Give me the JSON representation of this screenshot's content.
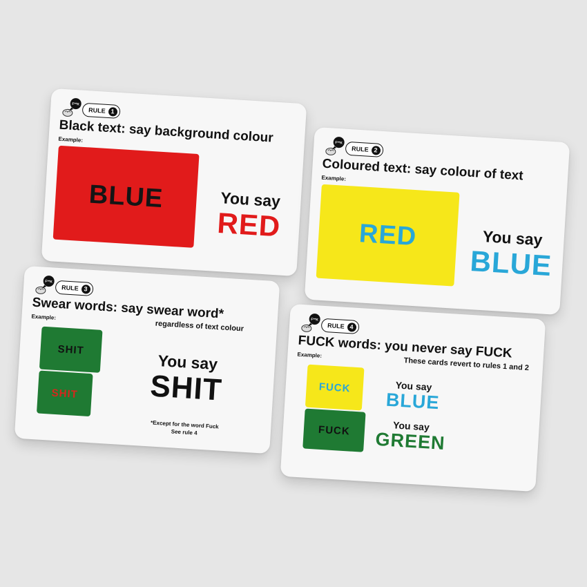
{
  "colors": {
    "background": "#e6e6e6",
    "card": "#f7f7f7",
    "red": "#e11b1b",
    "yellow": "#f6e71a",
    "blue": "#29a7d8",
    "green": "#1f7a33",
    "black": "#111111"
  },
  "logo_text": "F**K",
  "cards": [
    {
      "rule_label": "RULE",
      "rule_number": "1",
      "heading": "Black text: say background colour",
      "example_label": "Example:",
      "swatches": [
        {
          "word": "BLUE",
          "background": "red",
          "text_color": "black"
        }
      ],
      "you_say": [
        {
          "label": "You say",
          "word": "RED"
        }
      ]
    },
    {
      "rule_label": "RULE",
      "rule_number": "2",
      "heading": "Coloured text: say colour of text",
      "example_label": "Example:",
      "swatches": [
        {
          "word": "RED",
          "background": "yellow",
          "text_color": "blue"
        }
      ],
      "you_say": [
        {
          "label": "You say",
          "word": "BLUE"
        }
      ]
    },
    {
      "rule_label": "RULE",
      "rule_number": "3",
      "heading": "Swear words: say swear word*",
      "subheading": "regardless of text colour",
      "example_label": "Example:",
      "swatches": [
        {
          "word": "SHIT",
          "background": "green",
          "text_color": "black"
        },
        {
          "word": "SHIT",
          "background": "green",
          "text_color": "red"
        }
      ],
      "you_say": [
        {
          "label": "You say",
          "word": "SHIT"
        }
      ],
      "footnote_line1": "*Except for the word Fuck",
      "footnote_line2": "See rule 4"
    },
    {
      "rule_label": "RULE",
      "rule_number": "4",
      "heading": "FUCK words: you never say FUCK",
      "subheading": "These cards revert to rules 1 and 2",
      "example_label": "Example:",
      "swatches": [
        {
          "word": "FUCK",
          "background": "yellow",
          "text_color": "blue"
        },
        {
          "word": "FUCK",
          "background": "green",
          "text_color": "black"
        }
      ],
      "you_say": [
        {
          "label": "You say",
          "word": "BLUE"
        },
        {
          "label": "You say",
          "word": "GREEN"
        }
      ]
    }
  ]
}
